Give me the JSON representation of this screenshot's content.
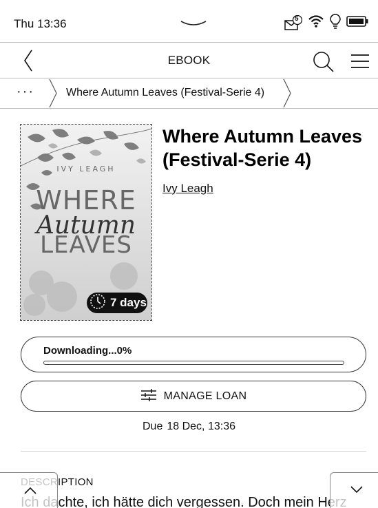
{
  "status_bar": {
    "time": "Thu 13:36",
    "notification_count": "5",
    "icons": [
      "mail-notification-icon",
      "wifi-icon",
      "lightbulb-icon",
      "battery-icon"
    ]
  },
  "header": {
    "title": "EBOOK",
    "icons": [
      "back-icon",
      "search-icon",
      "menu-icon"
    ]
  },
  "breadcrumb": {
    "more": "···",
    "current": "Where Autumn Leaves (Festival-Serie 4)"
  },
  "book": {
    "title": "Where Autumn Leaves (Festival-Serie 4)",
    "author": "Ivy Leagh",
    "cover": {
      "author_text": "IVY LEAGH",
      "title_line1": "WHERE",
      "title_line2": "Autumn",
      "title_line3": "LEAVES"
    },
    "loan_badge": "7 days"
  },
  "download": {
    "label": "Downloading...0%",
    "progress": 0
  },
  "manage_loan": {
    "label": "MANAGE LOAN"
  },
  "due": {
    "label": "Due",
    "value": "18 Dec, 13:36"
  },
  "description": {
    "heading": "DESCRIPTION",
    "text": "Ich dachte, ich hätte dich vergessen. Doch mein Herz"
  },
  "colors": {
    "text": "#111111",
    "border": "#333333",
    "badge_bg": "#111111"
  }
}
